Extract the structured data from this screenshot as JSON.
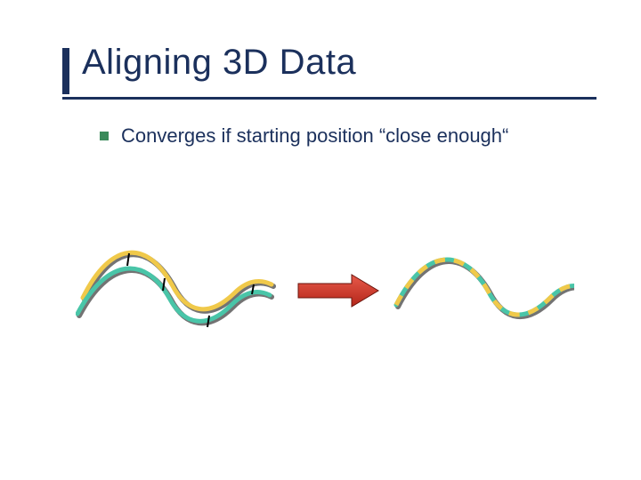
{
  "title": "Aligning 3D Data",
  "bullet": "Converges if starting position “close enough“",
  "colors": {
    "accent_navy": "#1b305c",
    "accent_green": "#3a8a5a",
    "curve_yellow": "#f0c94a",
    "curve_teal": "#49c5a8",
    "arrow_red": "#d12f2f",
    "arrow_red_dark": "#8a1f15"
  },
  "figure": {
    "description": "Two wavy curves (yellow and teal) initially misaligned on the left, a red arrow pointing right, and the same curves aligned/overlapping on the right shown as alternating dashes.",
    "arrow_direction": "right"
  }
}
